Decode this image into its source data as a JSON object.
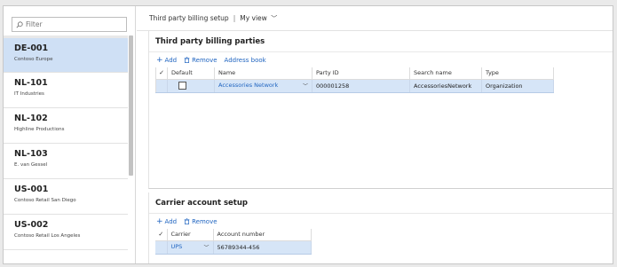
{
  "filter": {
    "placeholder": "Filter"
  },
  "list": [
    {
      "id": "DE-001",
      "name": "Contoso Europe"
    },
    {
      "id": "NL-101",
      "name": "IT Industries"
    },
    {
      "id": "NL-102",
      "name": "Highline Productions"
    },
    {
      "id": "NL-103",
      "name": "E. van Gessel"
    },
    {
      "id": "US-001",
      "name": "Contoso Retail San Diego"
    },
    {
      "id": "US-002",
      "name": "Contoso Retail Los Angeles"
    }
  ],
  "header": {
    "title": "Third party billing setup",
    "separator": "|",
    "view": "My view"
  },
  "billing": {
    "title": "Third party billing parties",
    "add_label": "Add",
    "remove_label": "Remove",
    "address_book_label": "Address book",
    "columns": [
      "Default",
      "Name",
      "Party ID",
      "Search name",
      "Type"
    ],
    "row": {
      "name": "Accessories Network",
      "party_id": "000001258",
      "search_name": "AccessoriesNetwork",
      "type": "Organization"
    }
  },
  "carrier": {
    "title": "Carrier account setup",
    "add_label": "Add",
    "remove_label": "Remove",
    "columns": [
      "Carrier",
      "Account number"
    ],
    "row": {
      "carrier": "UPS",
      "account_number": "56789344-456"
    }
  }
}
